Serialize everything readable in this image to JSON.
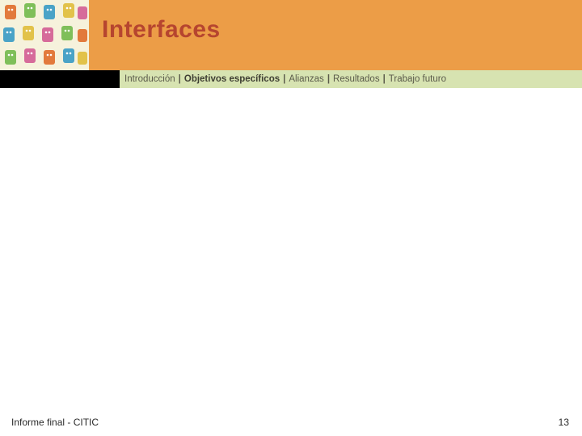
{
  "header": {
    "title": "Interfaces"
  },
  "breadcrumb": {
    "items": [
      {
        "label": "Introducción",
        "active": false
      },
      {
        "label": "Objetivos específicos",
        "active": true
      },
      {
        "label": "Alianzas",
        "active": false
      },
      {
        "label": "Resultados",
        "active": false
      },
      {
        "label": "Trabajo futuro",
        "active": false
      }
    ],
    "separator": "|"
  },
  "footer": {
    "left": "Informe final - CITIC",
    "page_number": "13"
  },
  "colors": {
    "banner": "#ec9d47",
    "title": "#b6452f",
    "crumb_bg": "#d7e3b1"
  }
}
